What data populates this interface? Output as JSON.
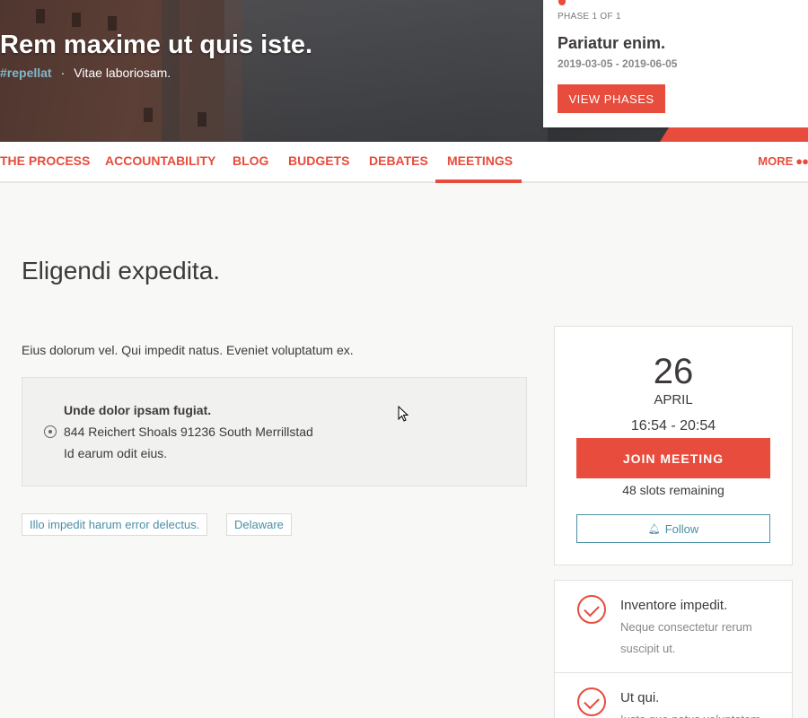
{
  "hero": {
    "title": "Rem maxime ut quis iste.",
    "hashtag": "#repellat",
    "subtitle": "Vitae laboriosam."
  },
  "phase": {
    "label": "PHASE 1 OF 1",
    "name": "Pariatur enim.",
    "dates": "2019-03-05 - 2019-06-05",
    "button": "VIEW PHASES"
  },
  "nav": {
    "items": [
      "THE PROCESS",
      "ACCOUNTABILITY",
      "BLOG",
      "BUDGETS",
      "DEBATES",
      "MEETINGS"
    ],
    "active": "MEETINGS",
    "more": "MORE"
  },
  "meeting": {
    "title": "Eligendi expedita.",
    "description": "Eius dolorum vel. Qui impedit natus. Eveniet voluptatum ex.",
    "address": {
      "name": "Unde dolor ipsam fugiat.",
      "line": "844 Reichert Shoals 91236 South Merrillstad",
      "extra": "Id earum odit eius."
    },
    "tags": [
      "Illo impedit harum error delectus.",
      "Delaware"
    ]
  },
  "sidebar": {
    "day": "26",
    "month": "APRIL",
    "time": "16:54 - 20:54",
    "join_label": "JOIN MEETING",
    "slots": "48 slots remaining",
    "follow_label": "Follow",
    "list": [
      {
        "title": "Inventore impedit.",
        "description": "Neque consectetur rerum suscipit ut."
      },
      {
        "title": "Ut qui.",
        "description": "Iusto quo natus voluptatem"
      }
    ]
  },
  "colors": {
    "accent": "#e74c3c",
    "secondary": "#4a8fa5",
    "text": "#3d393c"
  },
  "icons": [
    "map-pin-icon",
    "bell-icon",
    "check-circle-icon",
    "more-dots-icon",
    "mouse-cursor-icon"
  ]
}
